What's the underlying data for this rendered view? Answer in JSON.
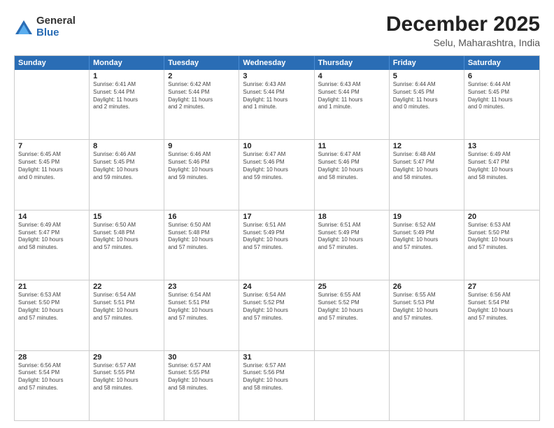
{
  "logo": {
    "general": "General",
    "blue": "Blue"
  },
  "title": "December 2025",
  "subtitle": "Selu, Maharashtra, India",
  "days": [
    "Sunday",
    "Monday",
    "Tuesday",
    "Wednesday",
    "Thursday",
    "Friday",
    "Saturday"
  ],
  "rows": [
    [
      {
        "num": "",
        "info": ""
      },
      {
        "num": "1",
        "info": "Sunrise: 6:41 AM\nSunset: 5:44 PM\nDaylight: 11 hours\nand 2 minutes."
      },
      {
        "num": "2",
        "info": "Sunrise: 6:42 AM\nSunset: 5:44 PM\nDaylight: 11 hours\nand 2 minutes."
      },
      {
        "num": "3",
        "info": "Sunrise: 6:43 AM\nSunset: 5:44 PM\nDaylight: 11 hours\nand 1 minute."
      },
      {
        "num": "4",
        "info": "Sunrise: 6:43 AM\nSunset: 5:44 PM\nDaylight: 11 hours\nand 1 minute."
      },
      {
        "num": "5",
        "info": "Sunrise: 6:44 AM\nSunset: 5:45 PM\nDaylight: 11 hours\nand 0 minutes."
      },
      {
        "num": "6",
        "info": "Sunrise: 6:44 AM\nSunset: 5:45 PM\nDaylight: 11 hours\nand 0 minutes."
      }
    ],
    [
      {
        "num": "7",
        "info": "Sunrise: 6:45 AM\nSunset: 5:45 PM\nDaylight: 11 hours\nand 0 minutes."
      },
      {
        "num": "8",
        "info": "Sunrise: 6:46 AM\nSunset: 5:45 PM\nDaylight: 10 hours\nand 59 minutes."
      },
      {
        "num": "9",
        "info": "Sunrise: 6:46 AM\nSunset: 5:46 PM\nDaylight: 10 hours\nand 59 minutes."
      },
      {
        "num": "10",
        "info": "Sunrise: 6:47 AM\nSunset: 5:46 PM\nDaylight: 10 hours\nand 59 minutes."
      },
      {
        "num": "11",
        "info": "Sunrise: 6:47 AM\nSunset: 5:46 PM\nDaylight: 10 hours\nand 58 minutes."
      },
      {
        "num": "12",
        "info": "Sunrise: 6:48 AM\nSunset: 5:47 PM\nDaylight: 10 hours\nand 58 minutes."
      },
      {
        "num": "13",
        "info": "Sunrise: 6:49 AM\nSunset: 5:47 PM\nDaylight: 10 hours\nand 58 minutes."
      }
    ],
    [
      {
        "num": "14",
        "info": "Sunrise: 6:49 AM\nSunset: 5:47 PM\nDaylight: 10 hours\nand 58 minutes."
      },
      {
        "num": "15",
        "info": "Sunrise: 6:50 AM\nSunset: 5:48 PM\nDaylight: 10 hours\nand 57 minutes."
      },
      {
        "num": "16",
        "info": "Sunrise: 6:50 AM\nSunset: 5:48 PM\nDaylight: 10 hours\nand 57 minutes."
      },
      {
        "num": "17",
        "info": "Sunrise: 6:51 AM\nSunset: 5:49 PM\nDaylight: 10 hours\nand 57 minutes."
      },
      {
        "num": "18",
        "info": "Sunrise: 6:51 AM\nSunset: 5:49 PM\nDaylight: 10 hours\nand 57 minutes."
      },
      {
        "num": "19",
        "info": "Sunrise: 6:52 AM\nSunset: 5:49 PM\nDaylight: 10 hours\nand 57 minutes."
      },
      {
        "num": "20",
        "info": "Sunrise: 6:53 AM\nSunset: 5:50 PM\nDaylight: 10 hours\nand 57 minutes."
      }
    ],
    [
      {
        "num": "21",
        "info": "Sunrise: 6:53 AM\nSunset: 5:50 PM\nDaylight: 10 hours\nand 57 minutes."
      },
      {
        "num": "22",
        "info": "Sunrise: 6:54 AM\nSunset: 5:51 PM\nDaylight: 10 hours\nand 57 minutes."
      },
      {
        "num": "23",
        "info": "Sunrise: 6:54 AM\nSunset: 5:51 PM\nDaylight: 10 hours\nand 57 minutes."
      },
      {
        "num": "24",
        "info": "Sunrise: 6:54 AM\nSunset: 5:52 PM\nDaylight: 10 hours\nand 57 minutes."
      },
      {
        "num": "25",
        "info": "Sunrise: 6:55 AM\nSunset: 5:52 PM\nDaylight: 10 hours\nand 57 minutes."
      },
      {
        "num": "26",
        "info": "Sunrise: 6:55 AM\nSunset: 5:53 PM\nDaylight: 10 hours\nand 57 minutes."
      },
      {
        "num": "27",
        "info": "Sunrise: 6:56 AM\nSunset: 5:54 PM\nDaylight: 10 hours\nand 57 minutes."
      }
    ],
    [
      {
        "num": "28",
        "info": "Sunrise: 6:56 AM\nSunset: 5:54 PM\nDaylight: 10 hours\nand 57 minutes."
      },
      {
        "num": "29",
        "info": "Sunrise: 6:57 AM\nSunset: 5:55 PM\nDaylight: 10 hours\nand 58 minutes."
      },
      {
        "num": "30",
        "info": "Sunrise: 6:57 AM\nSunset: 5:55 PM\nDaylight: 10 hours\nand 58 minutes."
      },
      {
        "num": "31",
        "info": "Sunrise: 6:57 AM\nSunset: 5:56 PM\nDaylight: 10 hours\nand 58 minutes."
      },
      {
        "num": "",
        "info": ""
      },
      {
        "num": "",
        "info": ""
      },
      {
        "num": "",
        "info": ""
      }
    ]
  ]
}
